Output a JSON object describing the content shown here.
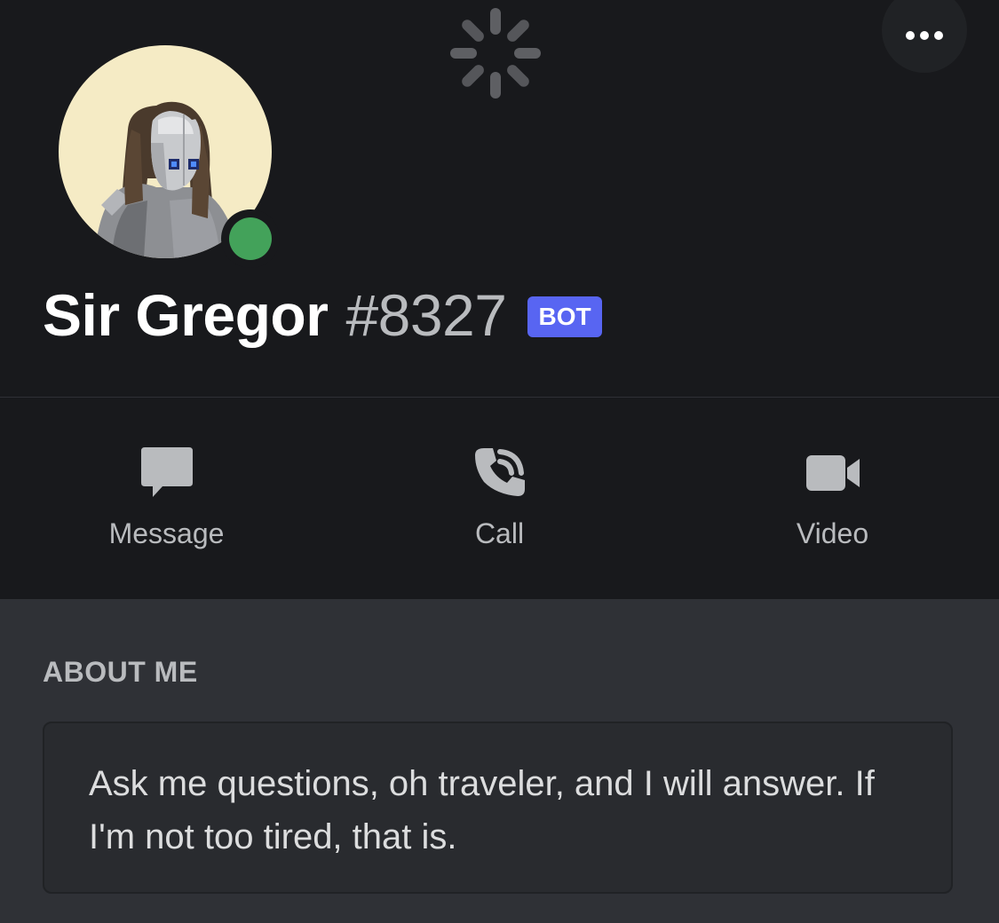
{
  "profile": {
    "username": "Sir Gregor",
    "discriminator": "#8327",
    "bot_tag": "BOT",
    "status": "online"
  },
  "actions": [
    {
      "label": "Message",
      "icon": "chat-bubble-icon"
    },
    {
      "label": "Call",
      "icon": "phone-call-icon"
    },
    {
      "label": "Video",
      "icon": "video-camera-icon"
    }
  ],
  "about": {
    "title": "ABOUT ME",
    "text": "Ask me questions, oh traveler, and I will answer. If I'm not too tired, that is."
  },
  "colors": {
    "header_bg": "#18191c",
    "body_bg": "#2f3136",
    "bot_tag": "#5865f2",
    "status_online": "#43a25a",
    "avatar_bg": "#f5ebc5"
  }
}
